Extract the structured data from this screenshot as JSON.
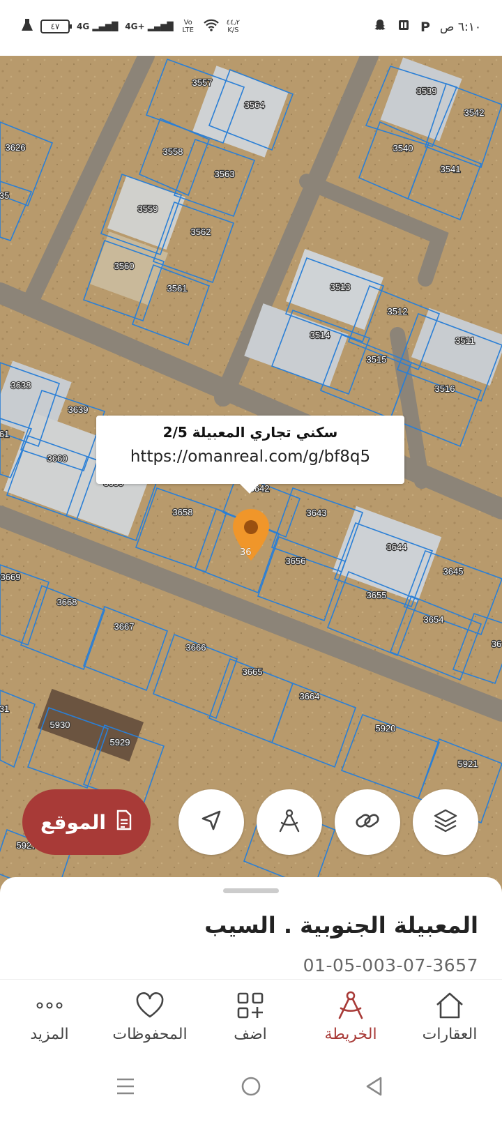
{
  "status_bar": {
    "time": "٦:١٠ ص",
    "battery": "٤٧",
    "net1": "4G",
    "net2": "4G+",
    "volte": "Vo LTE",
    "speed_value": "٤٤٫٢",
    "speed_unit": "K/S"
  },
  "map": {
    "plot_labels": [
      "3557",
      "3564",
      "3539",
      "3542",
      "3626",
      "3558",
      "3563",
      "3540",
      "3541",
      "3559",
      "3562",
      "3560",
      "3561",
      "3513",
      "3512",
      "3511",
      "3514",
      "3515",
      "3516",
      "3638",
      "3639",
      "3660",
      "3659",
      "3642",
      "3658",
      "3643",
      "3656",
      "3644",
      "3645",
      "3655",
      "3654",
      "3669",
      "3668",
      "3667",
      "3666",
      "3665",
      "3664",
      "5930",
      "5929",
      "5920",
      "5921",
      "5927",
      "35",
      "61",
      "31",
      "36"
    ],
    "popup_title": "سكني تجاري المعبيلة 2/5",
    "popup_link": "https://omanreal.com/g/bf8q5",
    "pin_color": "#f0962a",
    "partial_plot_label": "36"
  },
  "actions": {
    "location_label": "الموقع",
    "location_icon": "document-icon",
    "accent": "#a83a37"
  },
  "sheet": {
    "title": "المعبيلة الجنوبية . السيب",
    "code": "01-05-003-07-3657"
  },
  "nav": {
    "items": [
      {
        "label": "العقارات",
        "icon": "home-icon"
      },
      {
        "label": "الخريطة",
        "icon": "compass-icon"
      },
      {
        "label": "اضف",
        "icon": "add-grid-icon"
      },
      {
        "label": "المحفوظات",
        "icon": "heart-icon"
      },
      {
        "label": "المزيد",
        "icon": "more-icon"
      }
    ]
  }
}
